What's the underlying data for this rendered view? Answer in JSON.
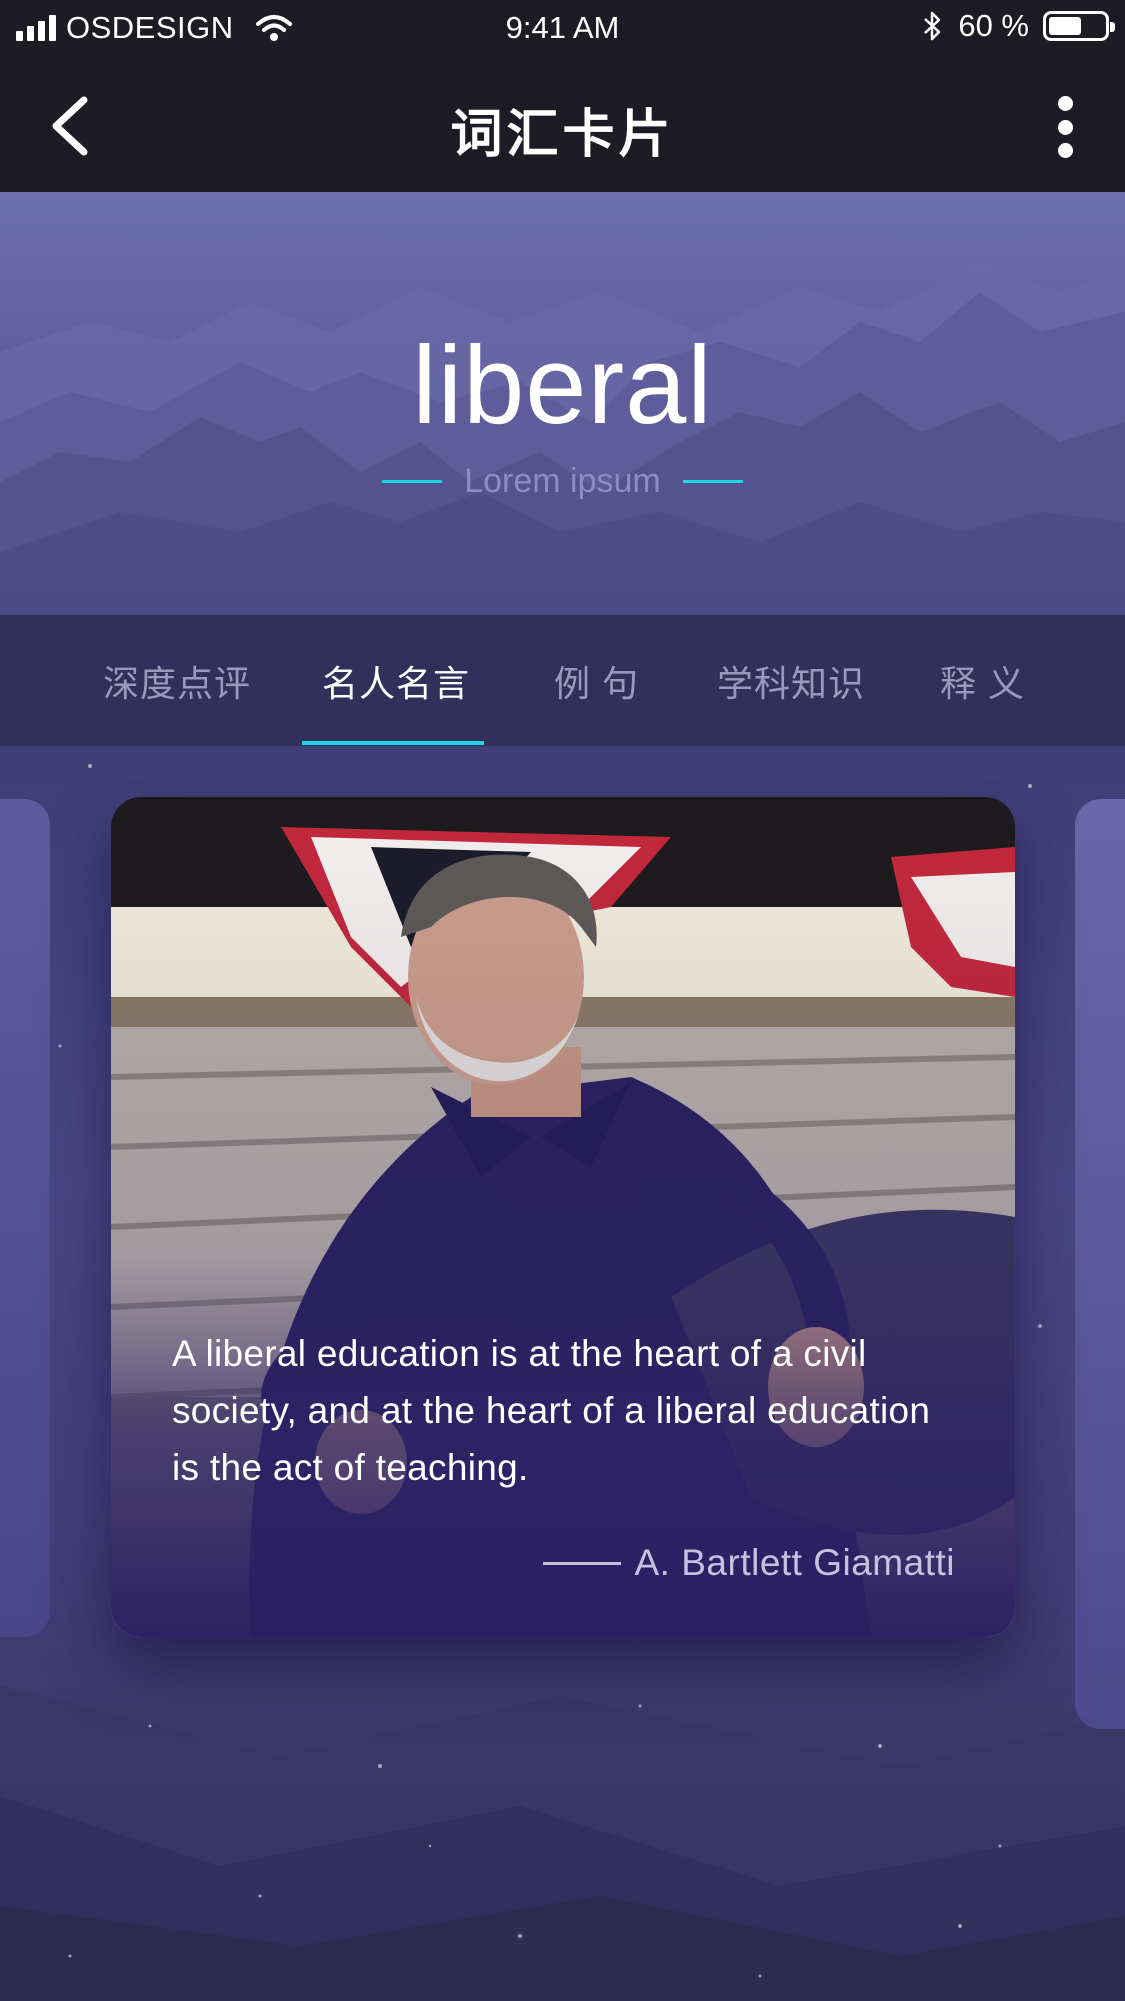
{
  "status_bar": {
    "carrier": "OSDESIGN",
    "time": "9:41 AM",
    "battery_percent": "60 %",
    "battery_level": 0.6,
    "icons": [
      "signal-icon",
      "wifi-icon",
      "bluetooth-icon",
      "battery-icon"
    ]
  },
  "nav": {
    "title": "词汇卡片",
    "back_icon": "chevron-left-icon",
    "more_icon": "more-vertical-icon"
  },
  "hero": {
    "word": "liberal",
    "subtitle": "Lorem ipsum"
  },
  "tabs": {
    "items": [
      "深度点评",
      "名人名言",
      "例 句",
      "学科知识",
      "释 义"
    ],
    "active_index": 1
  },
  "quote": {
    "text": "A liberal education is at the heart of a civil society, and at the heart of a liberal education is the act of teaching.",
    "author": "A. Bartlett Giamatti"
  },
  "colors": {
    "accent": "#19d8e6",
    "bar_background": "#1c1b26",
    "tab_background": "#32305a",
    "hero_background": "#6c6fae"
  }
}
